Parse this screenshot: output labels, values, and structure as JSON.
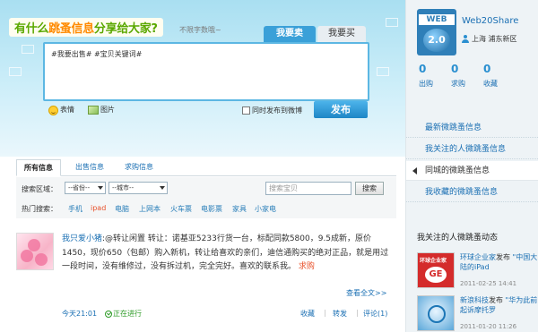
{
  "composer": {
    "headline_prefix": "有什么",
    "headline_highlight": "跳蚤信息",
    "headline_suffix": "分享给大家?",
    "limit_note": "不限字数哦~",
    "tab_sell": "我要卖",
    "tab_buy": "我要买",
    "draft_text": "#我要出售#  #宝贝关键词#",
    "emoji_label": "表情",
    "image_label": "图片",
    "weibo_label": "同时发布到微博",
    "publish_label": "发布"
  },
  "filters": {
    "tabs": [
      "所有信息",
      "出售信息",
      "求购信息"
    ],
    "region_label": "搜索区域：",
    "province": "--省份--",
    "city": "--城市--",
    "search_placeholder": "搜索宝贝",
    "search_button": "搜索",
    "hot_label": "热门搜索：",
    "hot_items": [
      "手机",
      "ipad",
      "电脑",
      "上网本",
      "火车票",
      "电影票",
      "家具",
      "小家电"
    ]
  },
  "feed": {
    "user": "我只爱小猪",
    "content": ":@转让闲置 转让：诺基亚5233行货一台，标配同款5800，9.5成新，原价1450，现价650（包邮）购入新机，转让给喜欢的亲们，迪信通购买的绝对正品，就是用过一段时间，没有维修过，没有拆过机，完全完好。喜欢的联系我。",
    "tag": "求购",
    "more": "查看全文>>",
    "time": "今天21:01",
    "status": "正在进行",
    "actions": [
      "收藏",
      "转发",
      "评论(1)"
    ]
  },
  "profile": {
    "logo_text_top": "WEB",
    "logo_text_bottom": "2.0",
    "name": "Web20Share",
    "location": "上海 浦东新区",
    "stats": [
      {
        "num": "0",
        "label": "出购"
      },
      {
        "num": "0",
        "label": "求购"
      },
      {
        "num": "0",
        "label": "收藏"
      }
    ]
  },
  "nav": {
    "latest": "最新微跳蚤信息",
    "follow": "我关注的人微跳蚤信息",
    "city": "同城的微跳蚤信息",
    "fav": "我收藏的微跳蚤信息"
  },
  "dynamics": {
    "title": "我关注的人微跳蚤动态",
    "items": [
      {
        "who": "环球企业家",
        "verb": "发布",
        "what": "\"中国大陆的iPad",
        "time": "2011-02-25 14:41",
        "img_text_top": "环球企业家",
        "img_text_main": "GE"
      },
      {
        "who": "新浪科技",
        "verb": "发布",
        "what": "\"华为此前起诉摩托罗",
        "time": "2011-01-20 11:26"
      }
    ]
  }
}
